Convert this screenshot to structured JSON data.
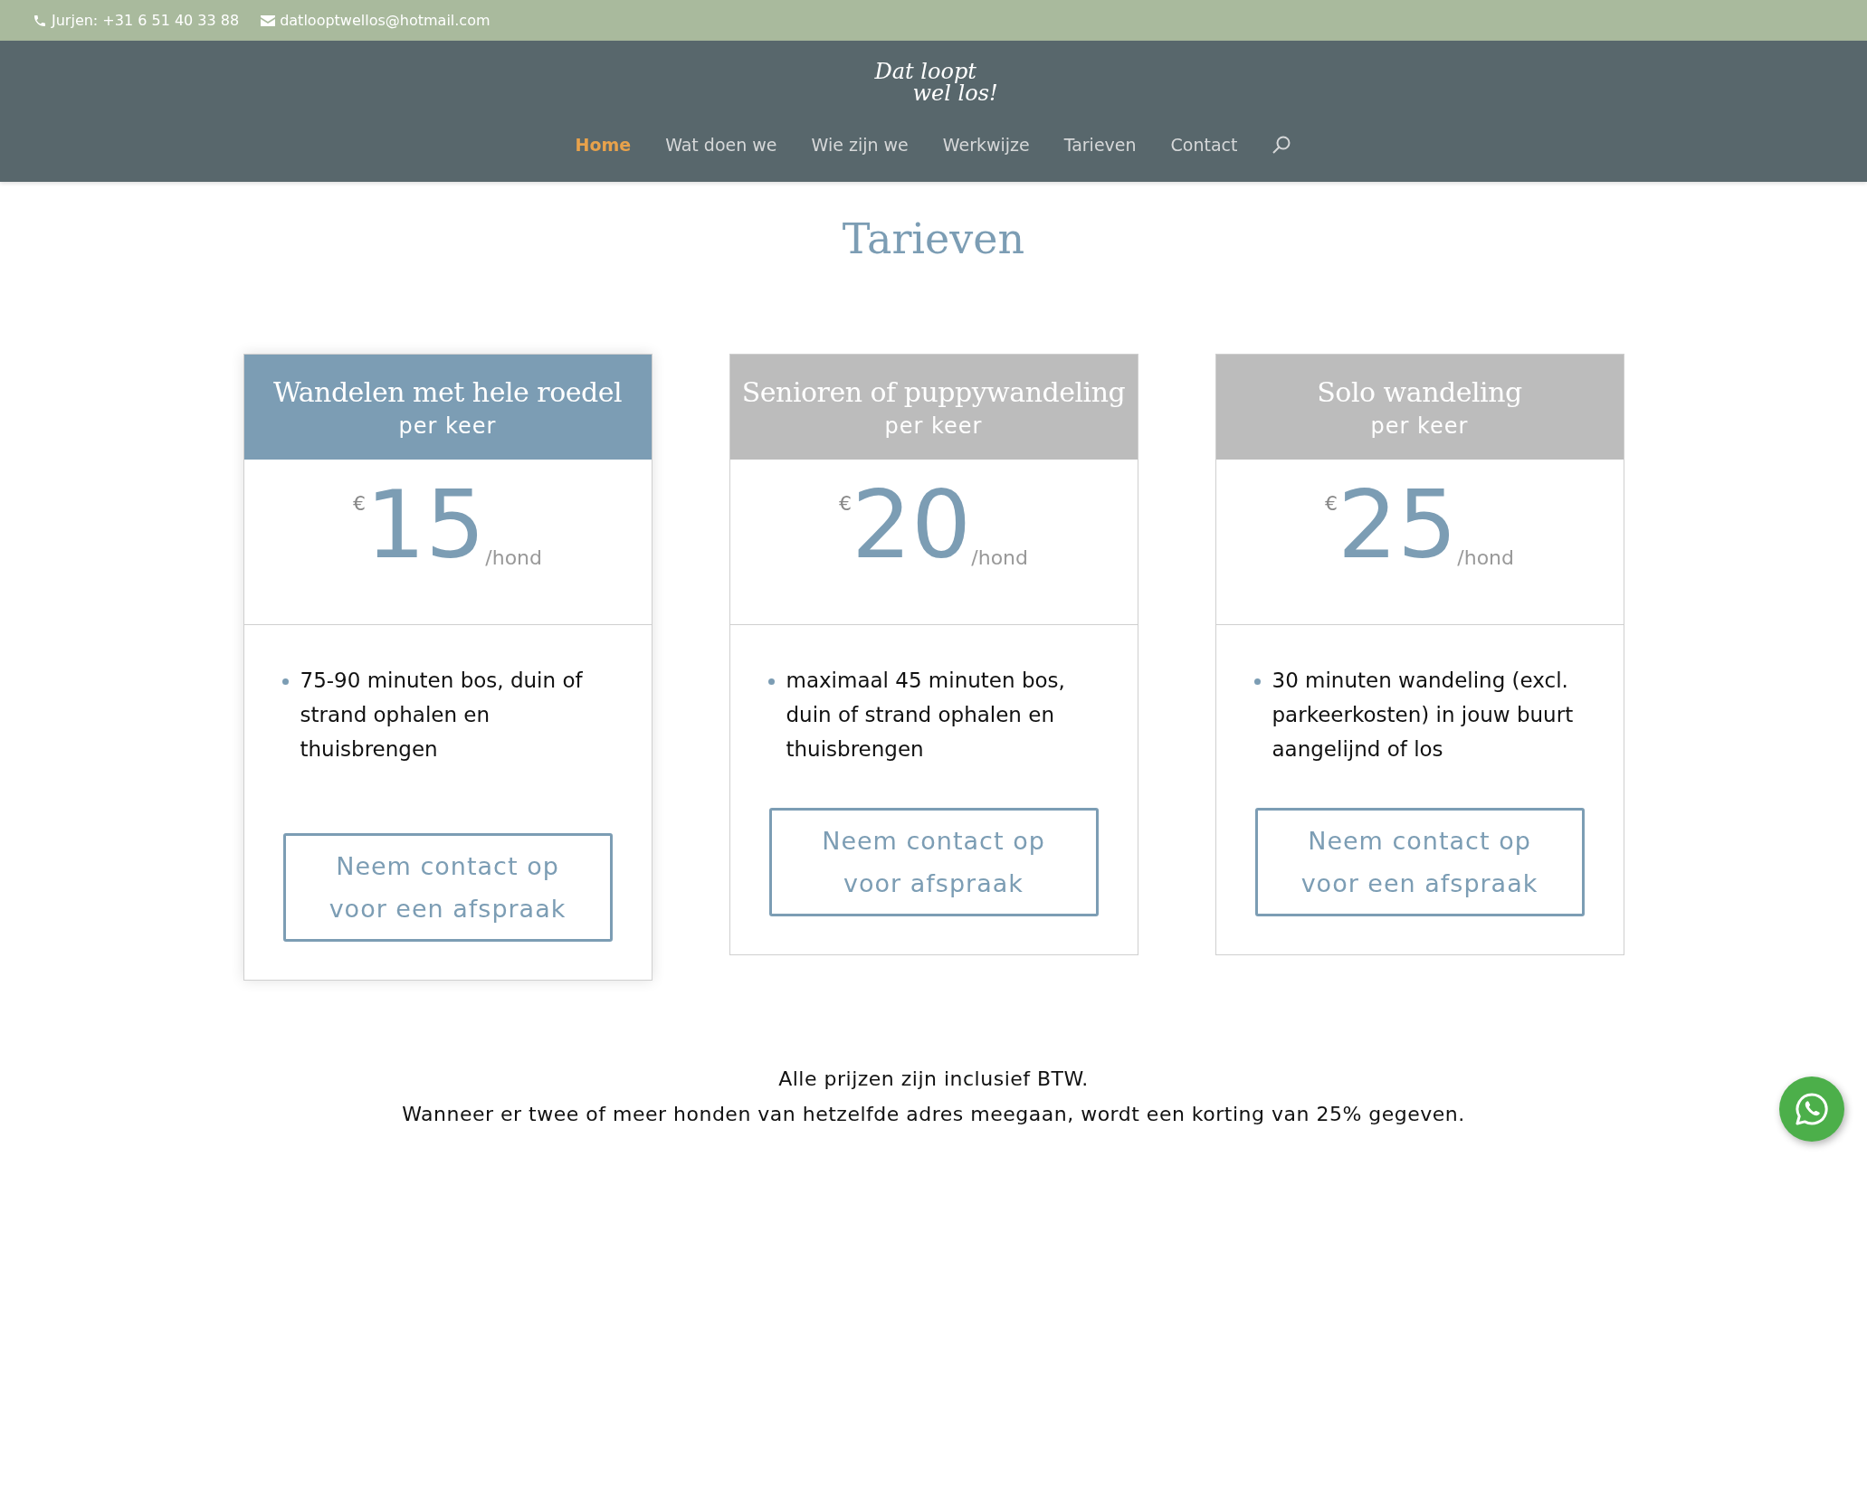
{
  "top_bar": {
    "phone": "Jurjen: +31 6 51 40 33 88",
    "email": "datlooptwellos@hotmail.com"
  },
  "logo": {
    "line_1": "Dat loopt",
    "line_2": "wel los!"
  },
  "nav": [
    {
      "label": "Home",
      "selected": true
    },
    {
      "label": "Wat doen we",
      "selected": false
    },
    {
      "label": "Wie zijn we",
      "selected": false
    },
    {
      "label": "Werkwijze",
      "selected": false
    },
    {
      "label": "Tarieven",
      "selected": false
    },
    {
      "label": "Contact",
      "selected": false
    }
  ],
  "page_title": "Tarieven",
  "pricing_cards": [
    {
      "title": "Wandelen met hele roedel",
      "subtitle": "per keer",
      "currency": "€",
      "price": "15",
      "unit": "/hond",
      "featured": true,
      "features": [
        "75-90 minuten bos, duin of strand ophalen en thuisbrengen"
      ],
      "button": "Neem contact op voor een afspraak"
    },
    {
      "title": "Senioren of puppywandeling",
      "subtitle": "per keer",
      "currency": "€",
      "price": "20",
      "unit": "/hond",
      "featured": false,
      "features": [
        "maximaal 45 minuten bos, duin of strand ophalen en thuisbrengen"
      ],
      "button": "Neem contact op voor afspraak"
    },
    {
      "title": "Solo wandeling",
      "subtitle": "per keer",
      "currency": "€",
      "price": "25",
      "unit": "/hond",
      "featured": false,
      "features": [
        "30 minuten wandeling (excl. parkeerkosten) in jouw buurt aangelijnd of los"
      ],
      "button": "Neem contact op voor een afspraak"
    }
  ],
  "notes": [
    "Alle prijzen zijn inclusief BTW.",
    "Wanneer er twee of meer honden van hetzelfde adres meegaan, wordt een korting van 25% gegeven."
  ]
}
